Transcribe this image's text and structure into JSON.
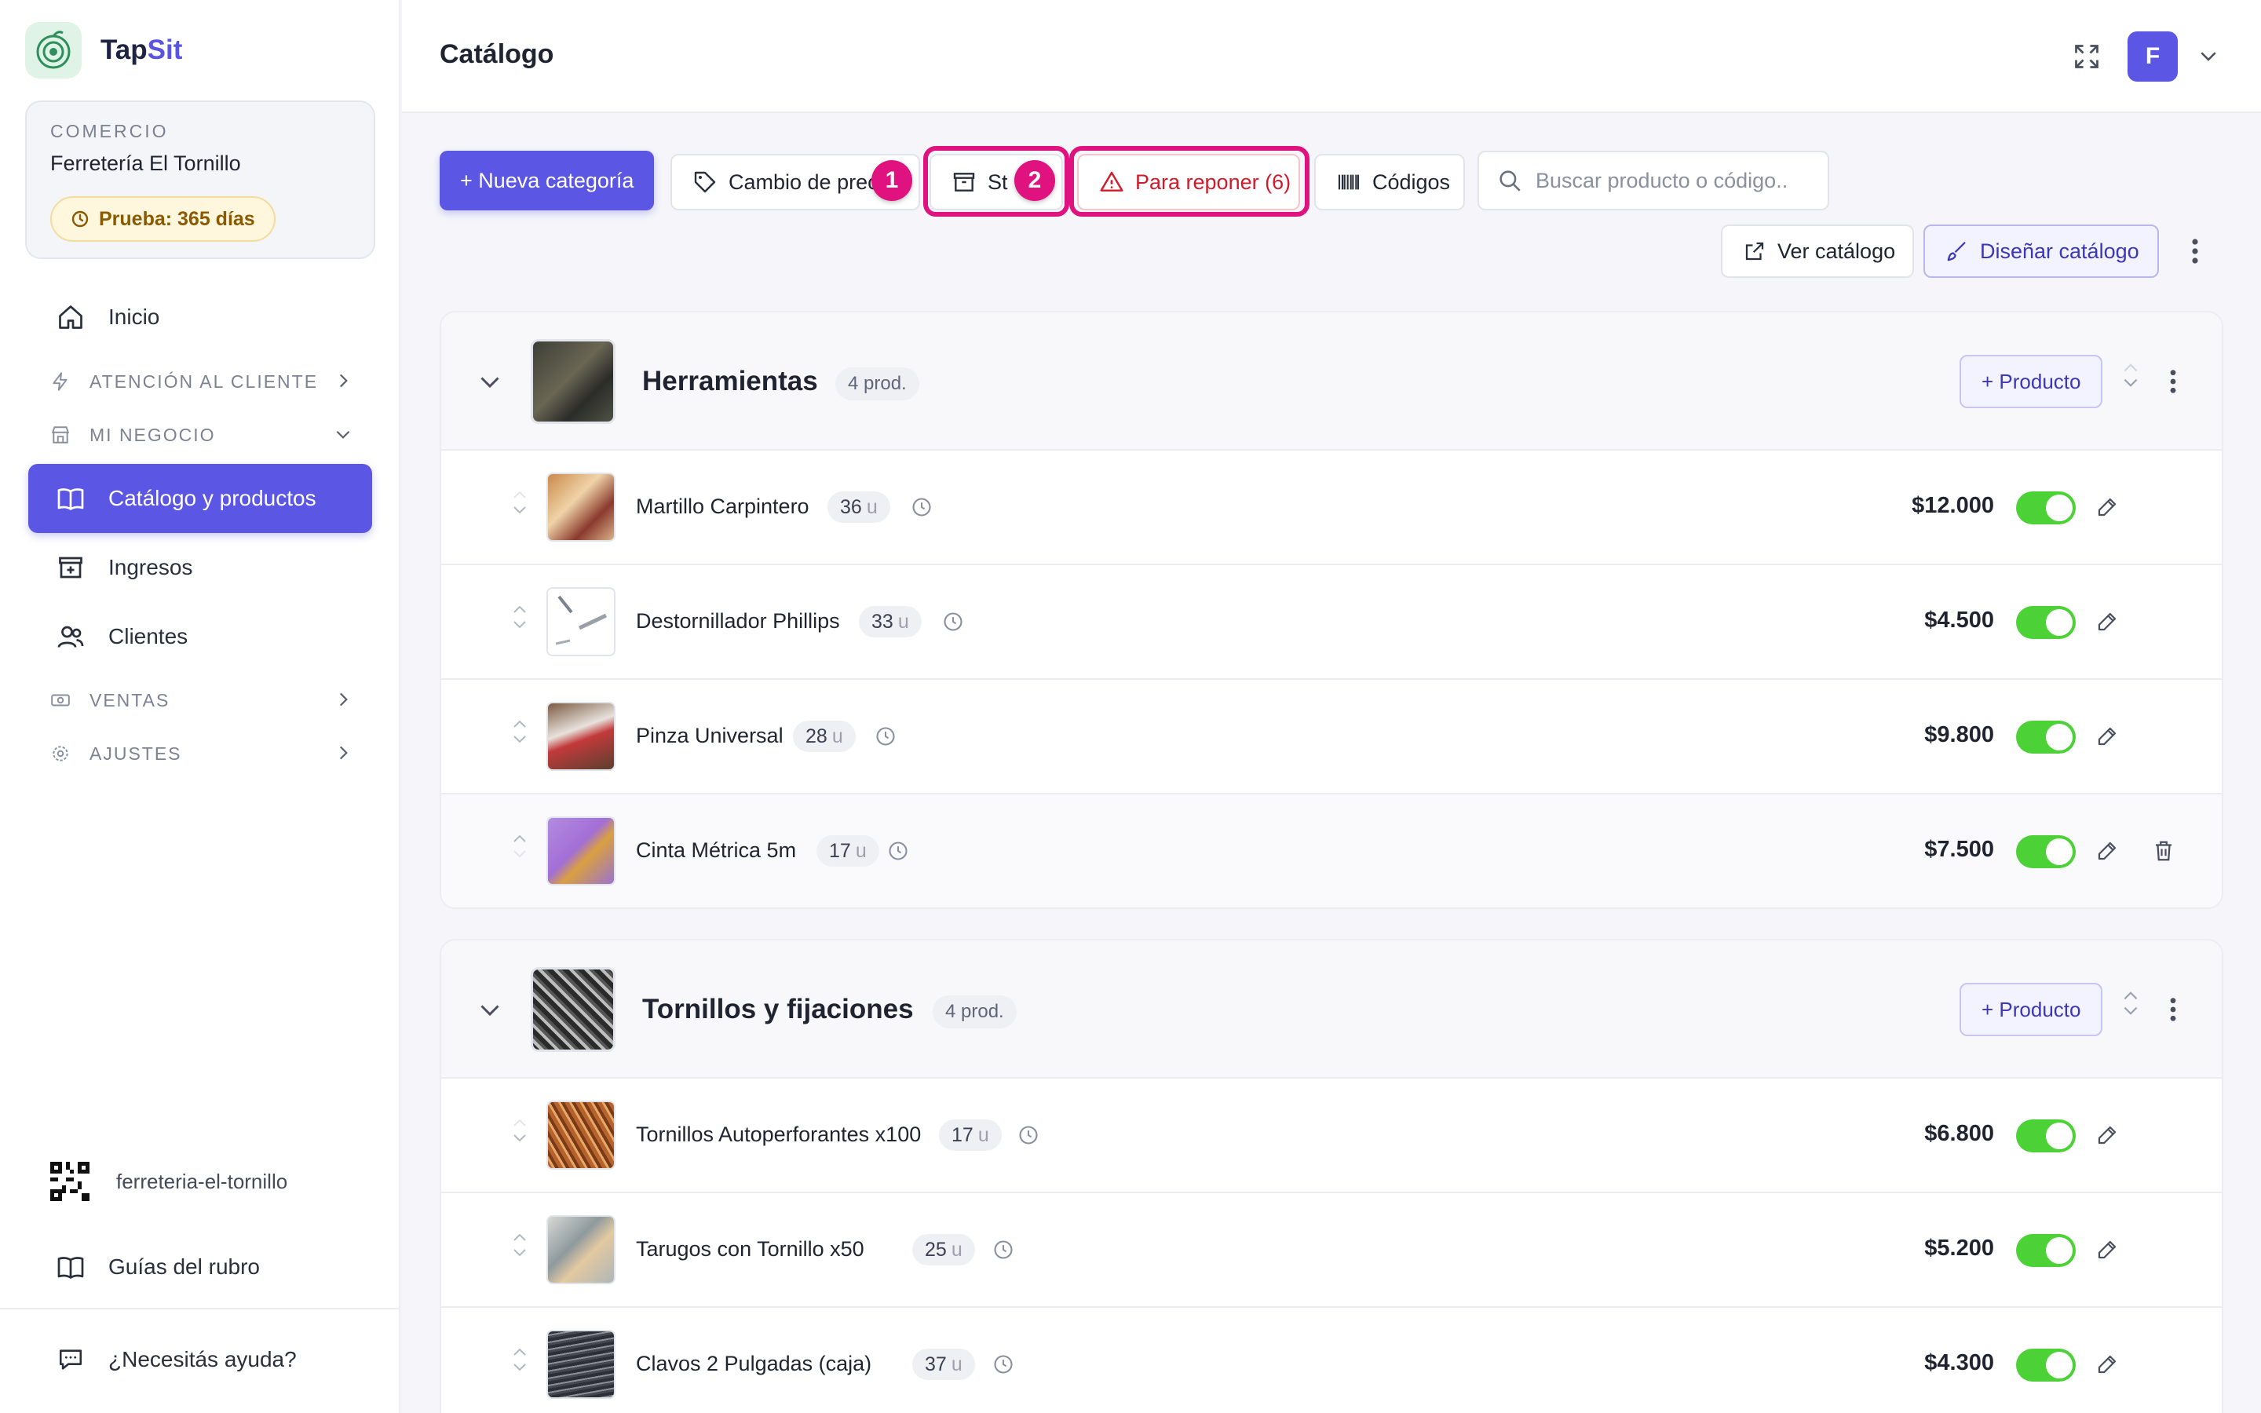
{
  "brand": {
    "name_part1": "Tap",
    "name_part2": "Sit"
  },
  "store": {
    "label": "COMERCIO",
    "name": "Ferretería El Tornillo",
    "trial": "Prueba: 365 días"
  },
  "nav": {
    "inicio": "Inicio",
    "atencion": "ATENCIÓN AL CLIENTE",
    "negocio": "MI NEGOCIO",
    "catalogo": "Catálogo y productos",
    "ingresos": "Ingresos",
    "clientes": "Clientes",
    "ventas": "VENTAS",
    "ajustes": "AJUSTES"
  },
  "footer": {
    "slug": "ferreteria-el-tornillo",
    "guides": "Guías del rubro",
    "help": "¿Necesitás ayuda?"
  },
  "header": {
    "title": "Catálogo",
    "avatar_initial": "F"
  },
  "toolbar": {
    "new_category": "+ Nueva categoría",
    "price_change": "Cambio de prec",
    "stock": "St",
    "restock": "Para reponer (6)",
    "codes": "Códigos",
    "search_placeholder": "Buscar producto o código..",
    "view_catalog": "Ver catálogo",
    "design_catalog": "Diseñar catálogo",
    "step1": "1",
    "step2": "2"
  },
  "categories": [
    {
      "name": "Herramientas",
      "count": "4 prod.",
      "add_label": "+ Producto",
      "products": [
        {
          "name": "Martillo Carpintero",
          "stock": "36",
          "unit": "u",
          "price": "$12.000"
        },
        {
          "name": "Destornillador Phillips",
          "stock": "33",
          "unit": "u",
          "price": "$4.500"
        },
        {
          "name": "Pinza Universal",
          "stock": "28",
          "unit": "u",
          "price": "$9.800"
        },
        {
          "name": "Cinta Métrica 5m",
          "stock": "17",
          "unit": "u",
          "price": "$7.500"
        }
      ]
    },
    {
      "name": "Tornillos y fijaciones",
      "count": "4 prod.",
      "add_label": "+ Producto",
      "products": [
        {
          "name": "Tornillos Autoperforantes x100",
          "stock": "17",
          "unit": "u",
          "price": "$6.800"
        },
        {
          "name": "Tarugos con Tornillo x50",
          "stock": "25",
          "unit": "u",
          "price": "$5.200"
        },
        {
          "name": "Clavos 2 Pulgadas (caja)",
          "stock": "37",
          "unit": "u",
          "price": "$4.300"
        }
      ]
    }
  ],
  "colors": {
    "accent": "#5b57e4",
    "highlight": "#e0127f",
    "toggle_on": "#4cd137",
    "warning": "#d11a2a"
  }
}
